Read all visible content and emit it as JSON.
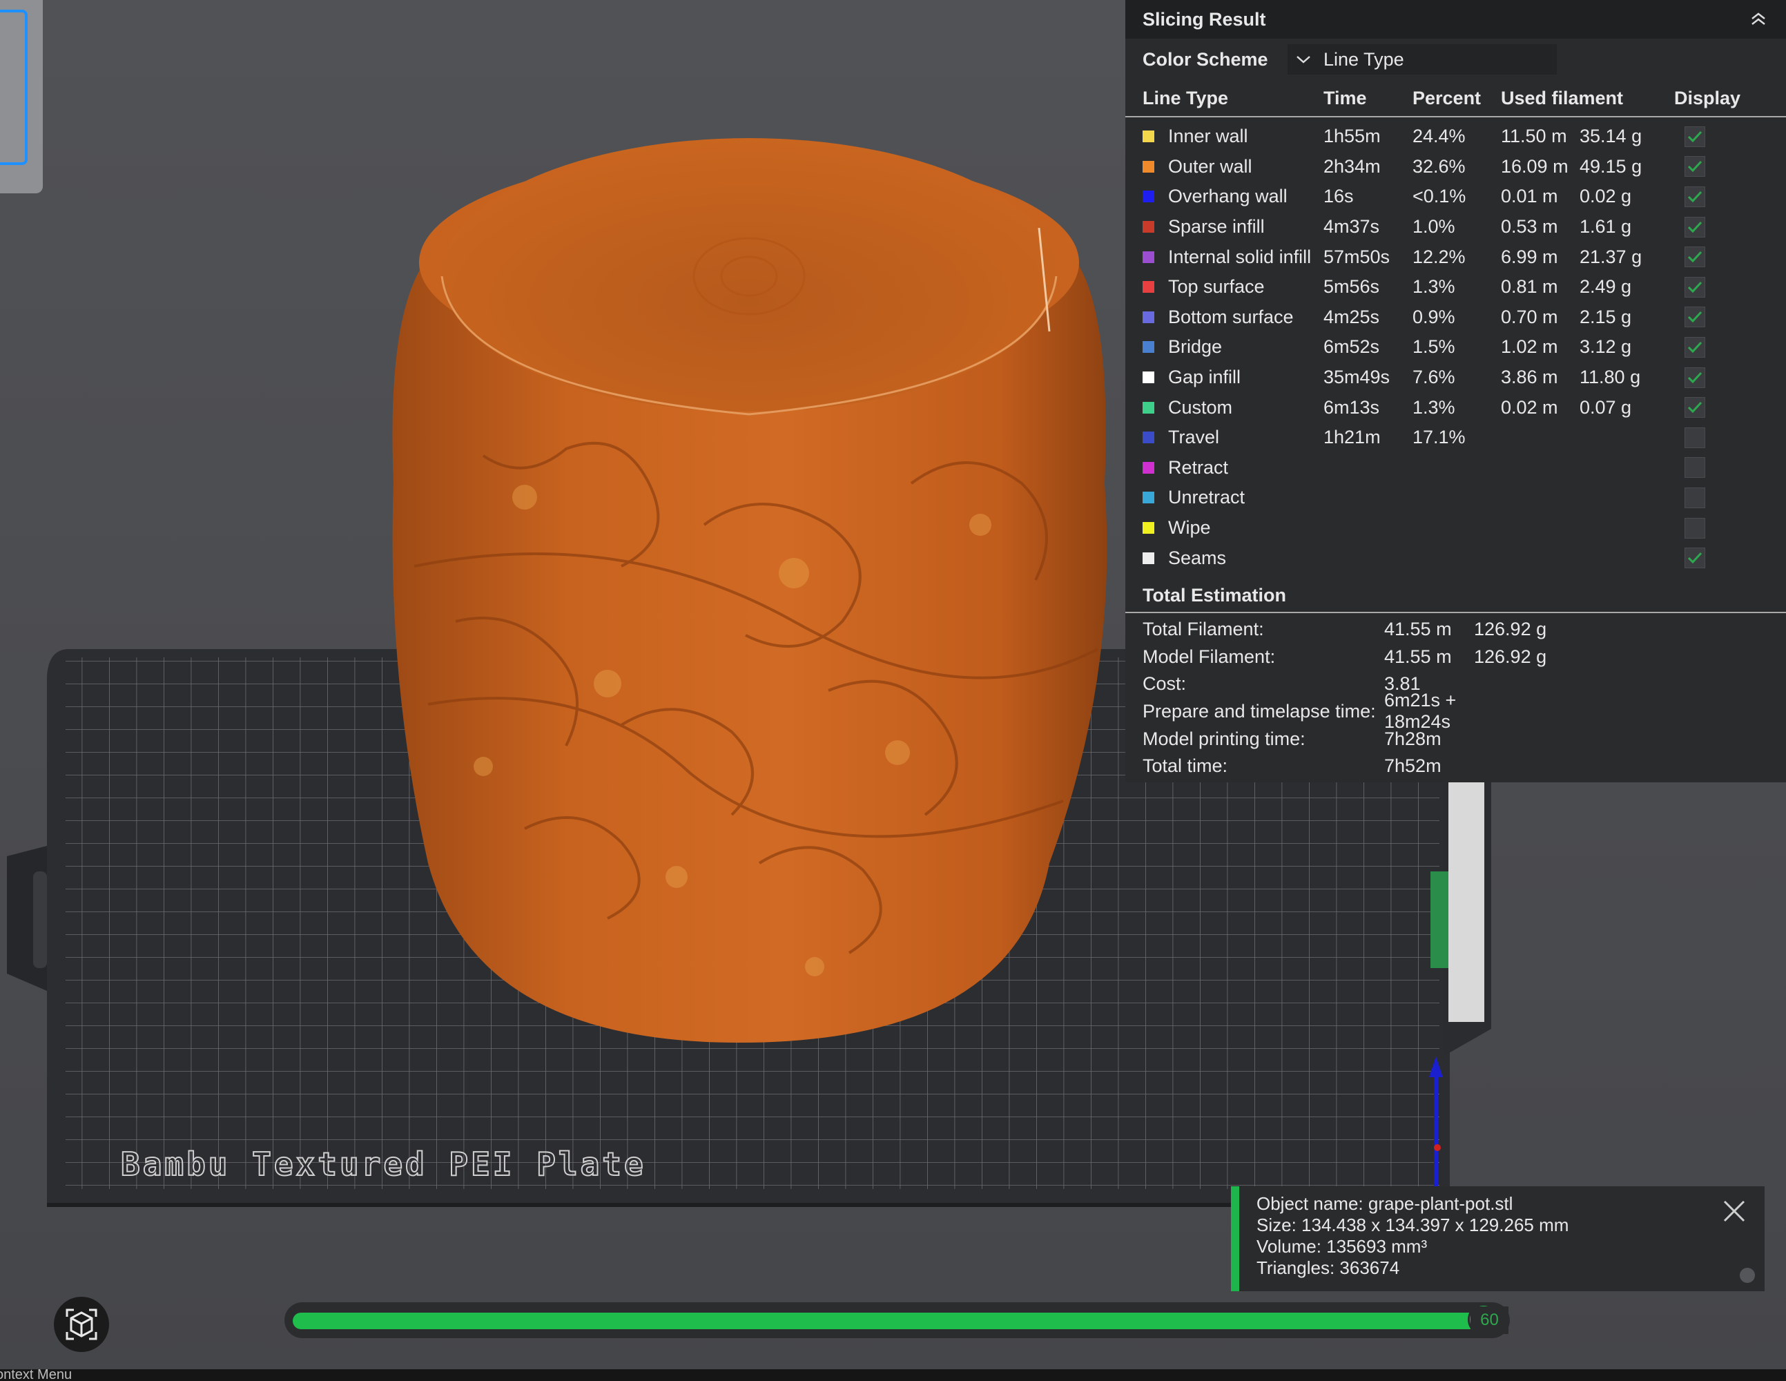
{
  "slicing_result": {
    "title": "Slicing Result",
    "color_scheme_label": "Color Scheme",
    "color_scheme_value": "Line Type",
    "columns": [
      "Line Type",
      "Time",
      "Percent",
      "Used filament",
      "Display"
    ],
    "rows": [
      {
        "type": "Inner wall",
        "time": "1h55m",
        "percent": "24.4%",
        "length": "11.50 m",
        "weight": "35.14 g",
        "color": "#f2d64b",
        "display": true
      },
      {
        "type": "Outer wall",
        "time": "2h34m",
        "percent": "32.6%",
        "length": "16.09 m",
        "weight": "49.15 g",
        "color": "#f08a2a",
        "display": true
      },
      {
        "type": "Overhang wall",
        "time": "16s",
        "percent": "<0.1%",
        "length": "0.01 m",
        "weight": "0.02 g",
        "color": "#1e1ef0",
        "display": true
      },
      {
        "type": "Sparse infill",
        "time": "4m37s",
        "percent": "1.0%",
        "length": "0.53 m",
        "weight": "1.61 g",
        "color": "#c83a2a",
        "display": true
      },
      {
        "type": "Internal solid infill",
        "time": "57m50s",
        "percent": "12.2%",
        "length": "6.99 m",
        "weight": "21.37 g",
        "color": "#9b4ed0",
        "display": true
      },
      {
        "type": "Top surface",
        "time": "5m56s",
        "percent": "1.3%",
        "length": "0.81 m",
        "weight": "2.49 g",
        "color": "#e84040",
        "display": true
      },
      {
        "type": "Bottom surface",
        "time": "4m25s",
        "percent": "0.9%",
        "length": "0.70 m",
        "weight": "2.15 g",
        "color": "#6a6ae0",
        "display": true
      },
      {
        "type": "Bridge",
        "time": "6m52s",
        "percent": "1.5%",
        "length": "1.02 m",
        "weight": "3.12 g",
        "color": "#4a80d0",
        "display": true
      },
      {
        "type": "Gap infill",
        "time": "35m49s",
        "percent": "7.6%",
        "length": "3.86 m",
        "weight": "11.80 g",
        "color": "#ffffff",
        "display": true
      },
      {
        "type": "Custom",
        "time": "6m13s",
        "percent": "1.3%",
        "length": "0.02 m",
        "weight": "0.07 g",
        "color": "#3ed08a",
        "display": true
      },
      {
        "type": "Travel",
        "time": "1h21m",
        "percent": "17.1%",
        "length": "",
        "weight": "",
        "color": "#3a4cc8",
        "display": false
      },
      {
        "type": "Retract",
        "time": "",
        "percent": "",
        "length": "",
        "weight": "",
        "color": "#d030d0",
        "display": false
      },
      {
        "type": "Unretract",
        "time": "",
        "percent": "",
        "length": "",
        "weight": "",
        "color": "#38a8d8",
        "display": false
      },
      {
        "type": "Wipe",
        "time": "",
        "percent": "",
        "length": "",
        "weight": "",
        "color": "#f0f020",
        "display": false
      },
      {
        "type": "Seams",
        "time": "",
        "percent": "",
        "length": "",
        "weight": "",
        "color": "#eeeeee",
        "display": true
      }
    ],
    "total_estimation": {
      "title": "Total Estimation",
      "items": [
        {
          "label": "Total Filament:",
          "v1": "41.55 m",
          "v2": "126.92 g"
        },
        {
          "label": "Model Filament:",
          "v1": "41.55 m",
          "v2": "126.92 g"
        },
        {
          "label": "Cost:",
          "v1": "3.81",
          "v2": ""
        },
        {
          "label": "Prepare and timelapse time:",
          "v1": "6m21s + 18m24s",
          "v2": ""
        },
        {
          "label": "Model printing time:",
          "v1": "7h28m",
          "v2": ""
        },
        {
          "label": "Total time:",
          "v1": "7h52m",
          "v2": ""
        }
      ]
    }
  },
  "object_info": {
    "name_line": "Object name: grape-plant-pot.stl",
    "size_line": "Size: 134.438 x 134.397 x 129.265 mm",
    "volume_line": "Volume: 135693 mm³",
    "triangles_line": "Triangles: 363674"
  },
  "plate_label": "Bambu Textured PEI Plate",
  "layer_slider": {
    "value": "60",
    "fraction": 0.985
  },
  "status_bar": {
    "text": "ontext Menu"
  },
  "colors": {
    "accent": "#1fbe4c",
    "model": "#c8631f",
    "panel": "#2a2b2d",
    "check": "#2ea84f"
  }
}
